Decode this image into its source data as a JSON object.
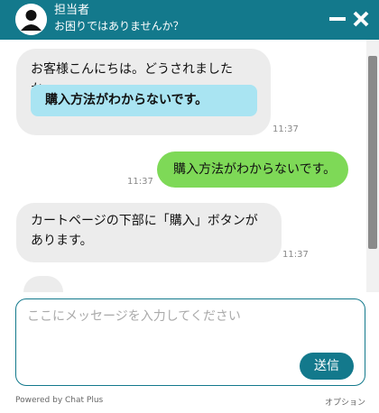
{
  "header": {
    "agent_name": "担当者",
    "subtitle": "お困りではありませんか？",
    "avatar_icon": "user-silhouette-icon",
    "minimize_icon": "minimize-icon",
    "close_icon": "close-icon",
    "color": "#13798c"
  },
  "messages": [
    {
      "sender": "operator",
      "text": "お客様こんにちは。どうされましたか。",
      "time": "11:37",
      "quick_reply": "購入方法がわからないです。"
    },
    {
      "sender": "user",
      "text": "購入方法がわからないです。",
      "time": "11:37"
    },
    {
      "sender": "operator",
      "text_line1": "カートページの下部に「購入」ボタンが",
      "text_line2": "あります。",
      "time": "11:37"
    },
    {
      "sender": "operator",
      "typing": "…"
    }
  ],
  "input": {
    "placeholder": "ここにメッセージを入力してください",
    "value": "",
    "send_label": "送信"
  },
  "footer": {
    "powered_by": "Powered by Chat Plus",
    "options_label": "オプション"
  },
  "colors": {
    "operator_bubble": "#ececec",
    "user_bubble": "#7ed957",
    "quick_reply": "#a9e4f2"
  }
}
